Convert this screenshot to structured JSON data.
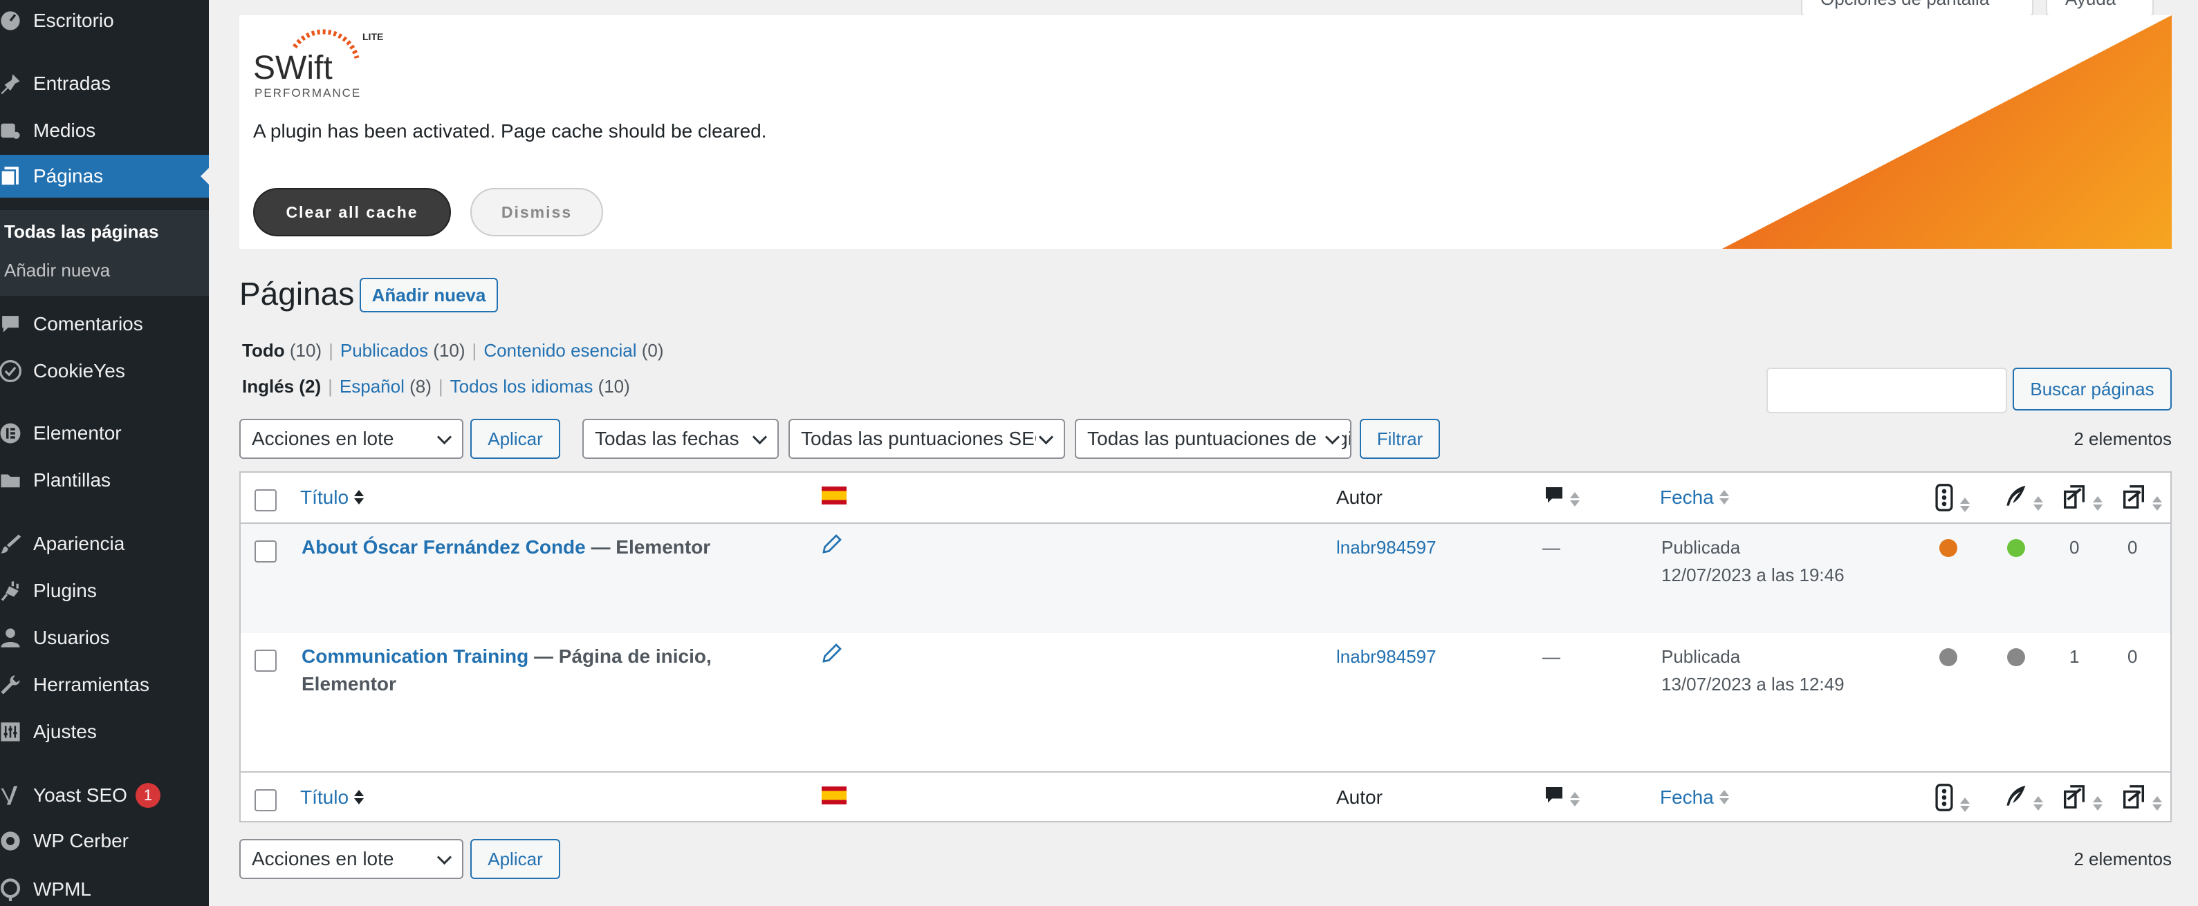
{
  "sidebar": {
    "items": [
      {
        "label": "Escritorio",
        "icon": "dashboard-icon"
      },
      {
        "label": "Entradas",
        "icon": "pin-icon"
      },
      {
        "label": "Medios",
        "icon": "media-icon"
      },
      {
        "label": "Páginas",
        "icon": "pages-icon"
      },
      {
        "label": "Comentarios",
        "icon": "comment-icon"
      },
      {
        "label": "CookieYes",
        "icon": "cookie-check-icon"
      },
      {
        "label": "Elementor",
        "icon": "elementor-icon"
      },
      {
        "label": "Plantillas",
        "icon": "folder-icon"
      },
      {
        "label": "Apariencia",
        "icon": "brush-icon"
      },
      {
        "label": "Plugins",
        "icon": "plug-icon"
      },
      {
        "label": "Usuarios",
        "icon": "user-icon"
      },
      {
        "label": "Herramientas",
        "icon": "wrench-icon"
      },
      {
        "label": "Ajustes",
        "icon": "settings-icon"
      },
      {
        "label": "Yoast SEO",
        "icon": "yoast-icon",
        "badge": "1"
      },
      {
        "label": "WP Cerber",
        "icon": "cerber-icon"
      },
      {
        "label": "WPML",
        "icon": "wpml-icon"
      }
    ],
    "submenu": [
      "Todas las páginas",
      "Añadir nueva"
    ]
  },
  "top": {
    "screen_options": "Opciones de pantalla",
    "help": "Ayuda"
  },
  "notice": {
    "logo_text": "SWift",
    "logo_sub": "PERFORMANCE",
    "logo_badge": "LITE",
    "message": "A plugin has been activated. Page cache should be cleared.",
    "clear_button": "Clear all cache",
    "dismiss_button": "Dismiss",
    "accent_color": "#f08a1c"
  },
  "heading": {
    "title": "Páginas",
    "add_new": "Añadir nueva"
  },
  "views": {
    "status": [
      {
        "label": "Todo",
        "count": "(10)"
      },
      {
        "label": "Publicados",
        "count": "(10)"
      },
      {
        "label": "Contenido esencial",
        "count": "(0)"
      }
    ],
    "languages": [
      {
        "label": "Inglés",
        "count": "(2)"
      },
      {
        "label": "Español",
        "count": "(8)"
      },
      {
        "label": "Todos los idiomas",
        "count": "(10)"
      }
    ]
  },
  "search": {
    "button": "Buscar páginas",
    "value": ""
  },
  "filters": {
    "bulk_actions": "Acciones en lote",
    "apply": "Aplicar",
    "dates": "Todas las fechas",
    "seo_scores": "Todas las puntuaciones SEO",
    "readability_scores": "Todas las puntuaciones de legibilidad",
    "filter": "Filtrar",
    "count": "2 elementos"
  },
  "table": {
    "columns": {
      "title": "Título",
      "author": "Autor",
      "date": "Fecha"
    },
    "rows": [
      {
        "title": "About Óscar Fernández Conde",
        "suffix": " — Elementor",
        "author": "lnabr984597",
        "comments": "—",
        "status": "Publicada",
        "date": "12/07/2023 a las 19:46",
        "seo_color": "#e2761b",
        "readability_color": "#6bc33b",
        "incoming_links": "0",
        "outgoing_links": "0"
      },
      {
        "title": "Communication Training",
        "suffix": " — Página de inicio, Elementor",
        "author": "lnabr984597",
        "comments": "—",
        "status": "Publicada",
        "date": "13/07/2023 a las 12:49",
        "seo_color": "#888888",
        "readability_color": "#888888",
        "incoming_links": "1",
        "outgoing_links": "0"
      }
    ]
  },
  "bottom": {
    "bulk_actions": "Acciones en lote",
    "apply": "Aplicar",
    "count": "2 elementos"
  }
}
